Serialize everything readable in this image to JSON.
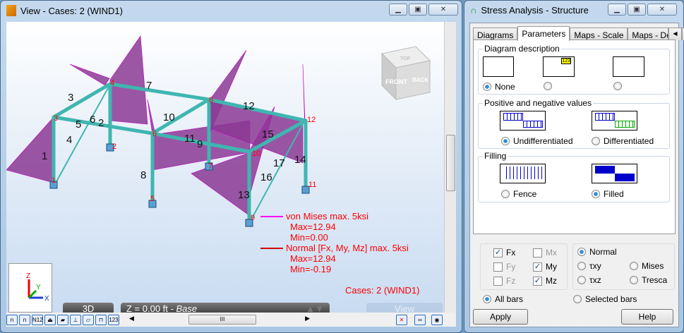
{
  "view": {
    "title": "View - Cases: 2 (WIND1)",
    "mode_label": "3D",
    "level_label": "Z = 0.00 ft",
    "level_suffix": "- Base",
    "view_button": "View",
    "cube_front": "FRONT",
    "cube_back": "BACK",
    "cube_top": "TOP",
    "axes": {
      "z": "Z",
      "y": "Y",
      "x": "X"
    },
    "legend": [
      {
        "title": "von Mises max. 5ksi",
        "max": "Max=12.94",
        "min": "Min=0.00",
        "color": "#ff00ff"
      },
      {
        "title": "Normal [Fx, My, Mz] max. 5ksi",
        "max": "Max=12.94",
        "min": "Min=-0.19",
        "color": "#cc0000"
      }
    ],
    "cases_label": "Cases: 2 (WIND1)",
    "member_labels": [
      "1",
      "2",
      "3",
      "4",
      "5",
      "6",
      "7",
      "8",
      "9",
      "10",
      "11",
      "12",
      "13",
      "14",
      "15",
      "16",
      "17"
    ],
    "node_labels": [
      "1",
      "2",
      "3",
      "4",
      "5",
      "6",
      "7",
      "8",
      "9",
      "10",
      "11",
      "12"
    ],
    "toolbar": [
      "n",
      "n",
      "N12",
      "",
      "",
      "",
      "",
      "",
      "123"
    ]
  },
  "stress": {
    "title": "Stress Analysis - Structure",
    "tabs": [
      "Diagrams",
      "Parameters",
      "Maps - Scale",
      "Maps - Def"
    ],
    "active_tab": "Parameters",
    "diagram_description": {
      "label": "Diagram description",
      "options": [
        "None",
        "",
        ""
      ],
      "selected": 0,
      "icon_text": "123"
    },
    "pos_neg": {
      "label": "Positive and negative values",
      "options": [
        "Undifferentiated",
        "Differentiated"
      ],
      "selected": 0
    },
    "filling": {
      "label": "Filling",
      "options": [
        "Fence",
        "Filled"
      ],
      "selected": 1
    },
    "components": [
      {
        "label": "Fx",
        "checked": true,
        "enabled": true
      },
      {
        "label": "Mx",
        "checked": false,
        "enabled": false
      },
      {
        "label": "Fy",
        "checked": false,
        "enabled": false
      },
      {
        "label": "My",
        "checked": true,
        "enabled": true
      },
      {
        "label": "Fz",
        "checked": false,
        "enabled": false
      },
      {
        "label": "Mz",
        "checked": true,
        "enabled": true
      }
    ],
    "stress_types": {
      "options": [
        "Normal",
        "τxy",
        "Mises",
        "τxz",
        "Tresca"
      ],
      "selected": "Normal"
    },
    "bars": {
      "options": [
        "All bars",
        "Selected bars"
      ],
      "selected": 0
    },
    "apply": "Apply",
    "help": "Help"
  },
  "colors": {
    "diagram": "#8b3a94",
    "member": "#3fb6b0",
    "label_red": "#ff0000",
    "legend_magenta": "#ff00ff"
  }
}
